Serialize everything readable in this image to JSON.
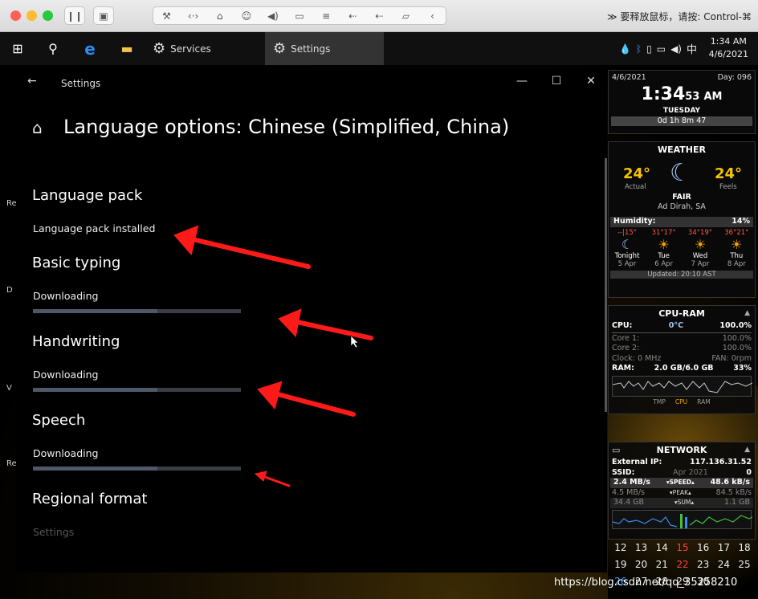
{
  "vm_toolbar": {
    "hint": "≫ 要释放鼠标，请按: Control-⌘",
    "traffic_colors": [
      "#fe5f57",
      "#febc2e",
      "#28c840"
    ]
  },
  "taskbar": {
    "apps": [
      {
        "name": "Services",
        "label": "Services"
      },
      {
        "name": "Settings",
        "label": "Settings"
      }
    ],
    "ime": "中",
    "clock_time": "1:34 AM",
    "clock_date": "4/6/2021"
  },
  "settings": {
    "window_title": "Settings",
    "page_title": "Language options: Chinese (Simplified, China)",
    "sections": [
      {
        "heading": "Language pack",
        "status": "Language pack installed",
        "progress": null
      },
      {
        "heading": "Basic typing",
        "status": "Downloading",
        "progress": 0.6
      },
      {
        "heading": "Handwriting",
        "status": "Downloading",
        "progress": 0.6
      },
      {
        "heading": "Speech",
        "status": "Downloading",
        "progress": 0.6
      },
      {
        "heading": "Regional format",
        "status": "Settings",
        "progress": null
      }
    ]
  },
  "widgets": {
    "clock": {
      "date": "4/6/2021",
      "day_num": "Day: 096",
      "hm": "1:34",
      "sec": "53",
      "ampm": "AM",
      "weekday": "TUESDAY",
      "uptime": "0d 1h 8m 47"
    },
    "weather": {
      "title": "WEATHER",
      "actual": "24°",
      "actual_label": "Actual",
      "feels": "24°",
      "feels_label": "Feels",
      "cond": "FAIR",
      "location": "Ad Dirah, SA",
      "humidity_label": "Humidity:",
      "humidity": "14%",
      "forecast": [
        {
          "temps": "--|15°",
          "day": "Tonight",
          "date": "5 Apr"
        },
        {
          "temps": "31°17°",
          "day": "Tue",
          "date": "6 Apr"
        },
        {
          "temps": "34°19°",
          "day": "Wed",
          "date": "7 Apr"
        },
        {
          "temps": "36°21°",
          "day": "Thu",
          "date": "8 Apr"
        }
      ],
      "updated": "Updated: 20:10 AST"
    },
    "cpu": {
      "title": "CPU-RAM",
      "cpu_label": "CPU:",
      "cpu_temp": "0°C",
      "cpu_pct": "100.0%",
      "core1": "Core 1:",
      "core1_pct": "100.0%",
      "core2": "Core 2:",
      "core2_pct": "100.0%",
      "clock": "Clock: 0 MHz",
      "fan": "FAN: 0rpm",
      "ram_label": "RAM:",
      "ram_val": "2.0 GB/6.0 GB",
      "ram_pct": "33%",
      "legend_tmp": "TMP",
      "legend_cpu": "CPU",
      "legend_ram": "RAM"
    },
    "network": {
      "title": "NETWORK",
      "ext_ip_label": "External IP:",
      "ext_ip": "117.136.31.52",
      "ssid_label": "SSID:",
      "ssid_date": "Apr 2021",
      "ssid_val": "0",
      "speed_dn": "2.4 MB/s",
      "speed_label": "▾SPEED▴",
      "speed_up": "48.6 kB/s",
      "peak_dn": "4.5 MB/s",
      "peak_label": "▾PEAK▴",
      "peak_up": "84.5 kB/s",
      "sum_dn": "34.4 GB",
      "sum_label": "▾SUM▴",
      "sum_up": "1.1 GB"
    },
    "calendar": [
      [
        "12",
        "13",
        "14",
        "15",
        "16",
        "17",
        "18"
      ],
      [
        "19",
        "20",
        "21",
        "22",
        "23",
        "24",
        "25"
      ],
      [
        "26",
        "27",
        "28",
        "29",
        "30",
        "",
        ""
      ]
    ]
  },
  "watermark": "https://blog.csdn.net/qq_35258210",
  "colors": {
    "arrow": "#ff1a1a",
    "progress_track": "#3a3d44",
    "progress_fill": "#4e5869",
    "accent_yellow": "#f5c400",
    "temp_red": "#ff5a4a"
  }
}
